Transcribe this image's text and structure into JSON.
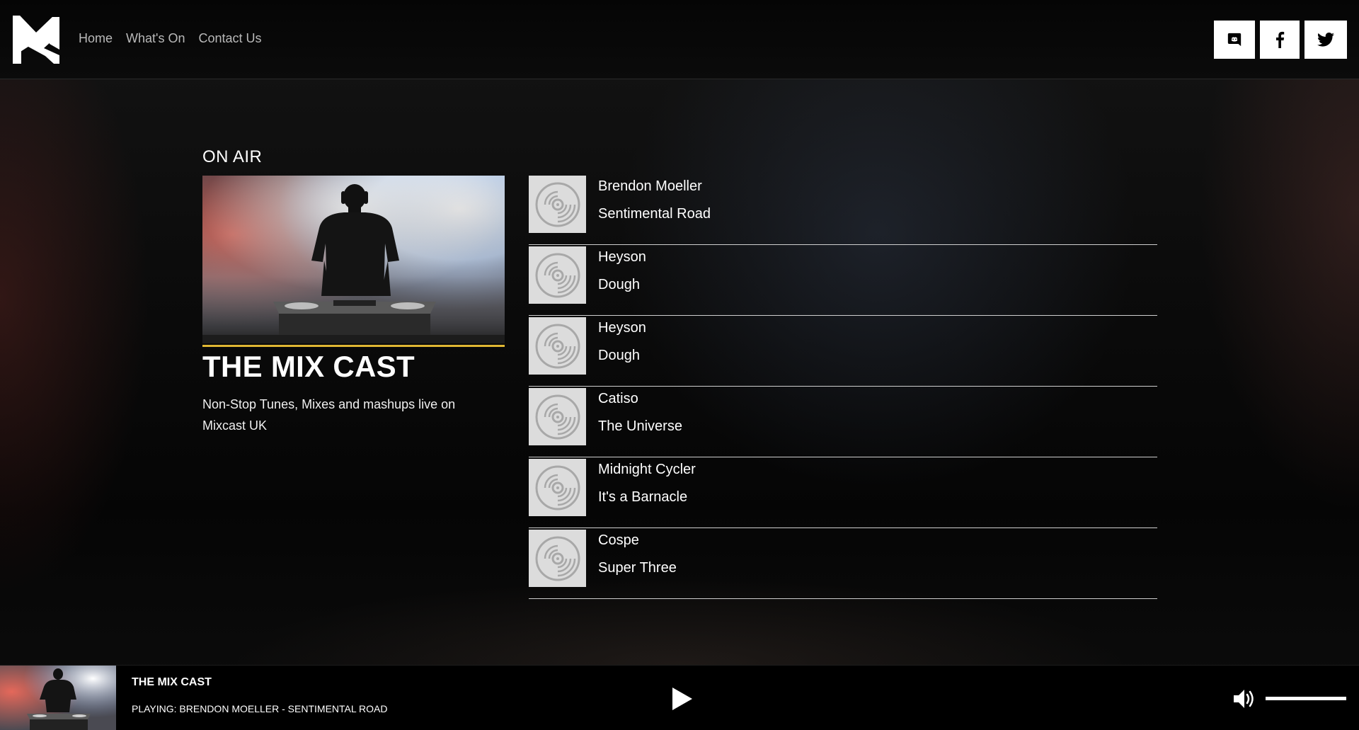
{
  "nav": {
    "items": [
      {
        "label": "Home"
      },
      {
        "label": "What's On"
      },
      {
        "label": "Contact Us"
      }
    ]
  },
  "social": {
    "icons": [
      "discord-icon",
      "facebook-icon",
      "twitter-icon"
    ]
  },
  "on_air": {
    "heading": "ON AIR",
    "show_title": "THE MIX CAST",
    "description": "Non-Stop Tunes, Mixes and mashups live on Mixcast UK",
    "accent_color": "#e0b733"
  },
  "tracks": [
    {
      "artist": "Brendon Moeller",
      "title": "Sentimental Road"
    },
    {
      "artist": "Heyson",
      "title": "Dough"
    },
    {
      "artist": "Heyson",
      "title": "Dough"
    },
    {
      "artist": "Catiso",
      "title": "The Universe"
    },
    {
      "artist": "Midnight Cycler",
      "title": "It's a Barnacle"
    },
    {
      "artist": "Cospe",
      "title": "Super Three"
    }
  ],
  "player": {
    "title": "THE MIX CAST",
    "now_playing": "PLAYING: BRENDON MOELLER - SENTIMENTAL ROAD",
    "volume_fraction": 1.0
  }
}
